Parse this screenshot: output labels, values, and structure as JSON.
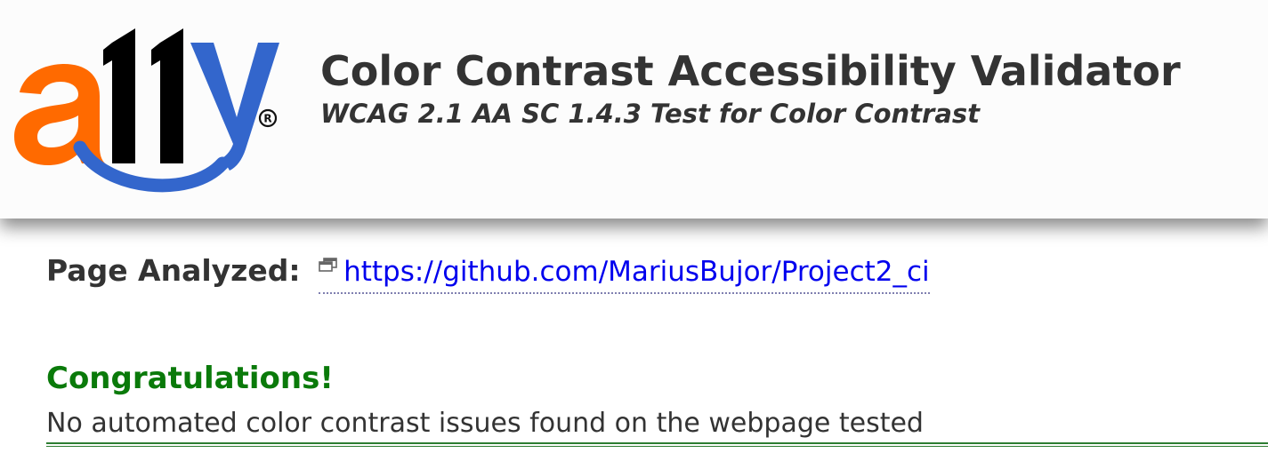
{
  "header": {
    "logo_text": "a11y",
    "logo_mark": "®",
    "title": "Color Contrast Accessibility Validator",
    "subtitle": "WCAG 2.1 AA SC 1.4.3 Test for Color Contrast"
  },
  "analysis": {
    "label": "Page Analyzed:",
    "url": "https://github.com/MariusBujor/Project2_ci",
    "link_icon": "new-window-icon"
  },
  "result": {
    "heading": "Congratulations!",
    "message": "No automated color contrast issues found on the webpage tested"
  },
  "colors": {
    "logo_a": "#ff6a00",
    "logo_ones": "#000000",
    "logo_y": "#3366cc",
    "success": "#0a7a0a",
    "link": "#0000ee",
    "text": "#333333"
  }
}
